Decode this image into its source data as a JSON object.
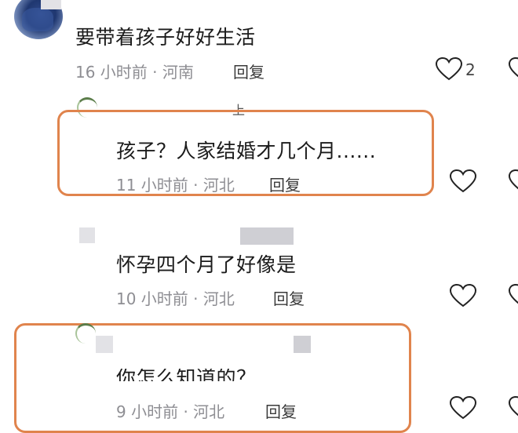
{
  "comments": [
    {
      "text": "要带着孩子好好生活",
      "time": "16 小时前",
      "location": "河南",
      "reply_label": "回复",
      "likes": "2"
    },
    {
      "text": "孩子？人家结婚才几个月......",
      "time": "11 小时前",
      "location": "河北",
      "reply_label": "回复"
    },
    {
      "text": "怀孕四个月了好像是",
      "time": "10 小时前",
      "location": "河北",
      "reply_label": "回复"
    },
    {
      "text": "你怎么知道的？",
      "time": "9 小时前",
      "location": "河北",
      "reply_label": "回复"
    }
  ],
  "separator": "·",
  "author_marker": "上",
  "colors": {
    "highlight": "#e0844d",
    "meta_text": "#8e8e93",
    "main_text": "#1b1b1b"
  },
  "icons": [
    "heart-outline-icon"
  ]
}
